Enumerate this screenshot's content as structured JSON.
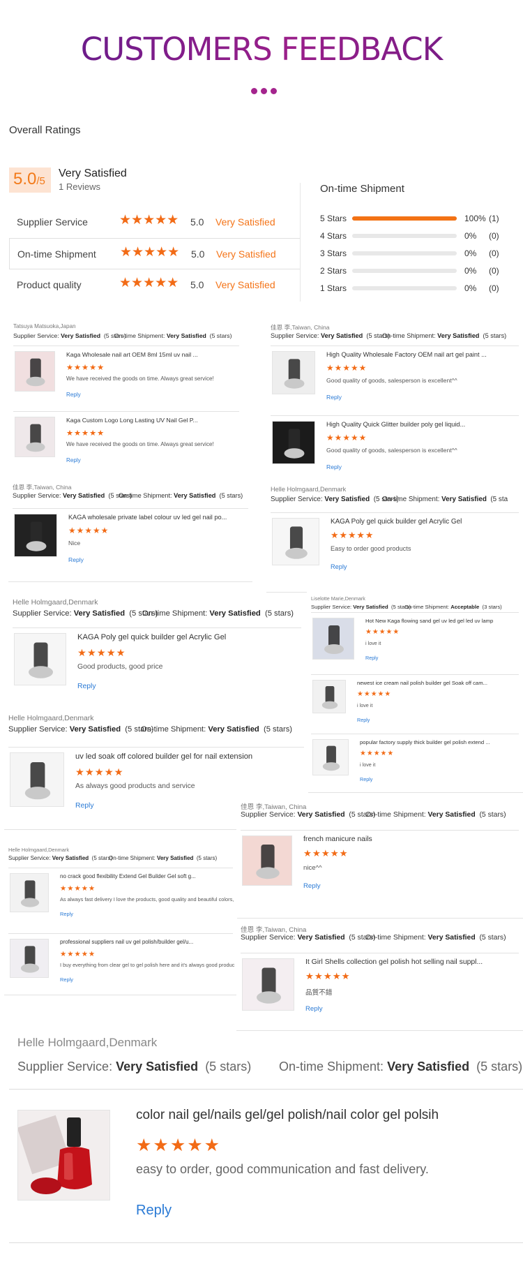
{
  "header": {
    "title": "CUSTOMERS FEEDBACK"
  },
  "overall": {
    "label": "Overall Ratings",
    "score": "5.0",
    "score_max": "/5",
    "summary": "Very Satisfied",
    "reviews": "1 Reviews",
    "rows": [
      {
        "label": "Supplier Service",
        "stars": 5,
        "value": "5.0",
        "text": "Very Satisfied"
      },
      {
        "label": "On-time Shipment",
        "stars": 5,
        "value": "5.0",
        "text": "Very Satisfied"
      },
      {
        "label": "Product quality",
        "stars": 5,
        "value": "5.0",
        "text": "Very Satisfied"
      }
    ],
    "shipment_title": "On-time Shipment",
    "distribution": [
      {
        "label": "5 Stars",
        "fraction": 1.0,
        "pct": "100%",
        "count": "(1)"
      },
      {
        "label": "4 Stars",
        "fraction": 0,
        "pct": "0%",
        "count": "(0)"
      },
      {
        "label": "3 Stars",
        "fraction": 0,
        "pct": "0%",
        "count": "(0)"
      },
      {
        "label": "2 Stars",
        "fraction": 0,
        "pct": "0%",
        "count": "(0)"
      },
      {
        "label": "1 Stars",
        "fraction": 0,
        "pct": "0%",
        "count": "(0)"
      }
    ]
  },
  "accent": {
    "orange": "#f26b16",
    "purple": "#7a1f8c",
    "link": "#2a7ad5"
  },
  "reviews": {
    "r1": {
      "who": "Tatsuya Matsuoka,Japan",
      "ss_label": "Supplier Service:",
      "ss": "Very Satisfied",
      "ss_stars": "(5 stars)",
      "os_label": "On-time Shipment:",
      "os": "Very Satisfied",
      "os_stars": "(5 stars)",
      "items": [
        {
          "title": "Kaga Wholesale nail art OEM 8ml 15ml uv nail ...",
          "comment": "We have received the goods on time. Always great service!",
          "reply": "Reply",
          "icon": "nail-swatch-icon"
        },
        {
          "title": "Kaga Custom Logo Long Lasting UV Nail Gel P...",
          "comment": "We have received the goods on time. Always great service!",
          "reply": "Reply",
          "icon": "color-chart-icon"
        }
      ]
    },
    "r2": {
      "who": "佳恩 李,Taiwan, China",
      "ss_label": "Supplier Service:",
      "ss": "Very Satisfied",
      "ss_stars": "(5 stars)",
      "os_label": "On-time Shipment:",
      "os": "Very Satisfied",
      "os_stars": "(5 stars)",
      "items": [
        {
          "title": "High Quality Wholesale Factory OEM nail art gel paint ...",
          "comment": "Good quality of goods, salesperson is excellent^^",
          "reply": "Reply"
        },
        {
          "title": "High Quality Quick Glitter builder poly gel liquid...",
          "comment": "Good quality of goods, salesperson is excellent^^",
          "reply": "Reply"
        }
      ]
    },
    "r3": {
      "who": "佳恩 李,Taiwan, China",
      "ss_label": "Supplier Service:",
      "ss": "Very Satisfied",
      "ss_stars": "(5 stars)",
      "os_label": "On-time Shipment:",
      "os": "Very Satisfied",
      "os_stars": "(5 stars)",
      "items": [
        {
          "title": "KAGA wholesale private label colour uv led gel nail po...",
          "comment": "Nice",
          "reply": "Reply"
        }
      ]
    },
    "r4": {
      "who": "Helle Holmgaard,Denmark",
      "ss_label": "Supplier Service:",
      "ss": "Very Satisfied",
      "ss_stars": "(5 stars)",
      "os_label": "On-time Shipment:",
      "os": "Very Satisfied",
      "os_stars": "(5 sta",
      "items": [
        {
          "title": "KAGA Poly gel quick builder gel Acrylic Gel",
          "comment": "Easy to order good products",
          "reply": "Reply"
        }
      ]
    },
    "r5": {
      "who": "Helle Holmgaard,Denmark",
      "ss_label": "Supplier Service:",
      "ss": "Very Satisfied",
      "ss_stars": "(5 stars)",
      "os_label": "On-time Shipment:",
      "os": "Very Satisfied",
      "os_stars": "(5 stars)",
      "items": [
        {
          "title": "KAGA Poly gel quick builder gel Acrylic Gel",
          "comment": "Good products, good price",
          "reply": "Reply"
        }
      ]
    },
    "r6": {
      "who": "Liselotte Marie,Denmark",
      "ss_label": "Supplier Service:",
      "ss": "Very Satisfied",
      "ss_stars": "(5 stars)",
      "os_label": "On-time Shipment:",
      "os": "Acceptable",
      "os_stars": "(3 stars)",
      "items": [
        {
          "title": "Hot New Kaga flowing sand gel uv led gel led uv lamp",
          "comment": "i love it",
          "reply": "Reply"
        },
        {
          "title": "newest ice cream nail polish builder gel Soak off cam...",
          "comment": "i love it",
          "reply": "Reply"
        },
        {
          "title": "popular factory supply thick builder gel polish extend ...",
          "comment": "i love it",
          "reply": "Reply"
        }
      ]
    },
    "r7": {
      "who": "Helle Holmgaard,Denmark",
      "ss_label": "Supplier Service:",
      "ss": "Very Satisfied",
      "ss_stars": "(5 stars)",
      "os_label": "On-time Shipment:",
      "os": "Very Satisfied",
      "os_stars": "(5 stars)",
      "items": [
        {
          "title": "uv led soak off colored builder gel for nail extension",
          "comment": "As always good products and service",
          "reply": "Reply"
        }
      ]
    },
    "r8": {
      "who": "佳恩 李,Taiwan, China",
      "ss_label": "Supplier Service:",
      "ss": "Very Satisfied",
      "ss_stars": "(5 stars)",
      "os_label": "On-time Shipment:",
      "os": "Very Satisfied",
      "os_stars": "(5 stars)",
      "items": [
        {
          "title": "french manicure nails",
          "comment": "nice^^",
          "reply": "Reply"
        }
      ]
    },
    "r9": {
      "who": "Helle Holmgaard,Denmark",
      "ss_label": "Supplier Service:",
      "ss": "Very Satisfied",
      "ss_stars": "(5 stars)",
      "os_label": "On-time Shipment:",
      "os": "Very Satisfied",
      "os_stars": "(5 stars)",
      "items": [
        {
          "title": "no crack good flexibility Extend Gel Builder Gel soft g...",
          "comment": "As always fast delivery I love the products, good quality and beautiful colors,",
          "reply": "Reply"
        },
        {
          "title": "professional suppliers nail uv gel polish/builder gel/u...",
          "comment": "I buy everything from clear gel to gel polish here and it's always good produc",
          "reply": "Reply"
        }
      ]
    },
    "r10": {
      "who": "佳恩 李,Taiwan, China",
      "ss_label": "Supplier Service:",
      "ss": "Very Satisfied",
      "ss_stars": "(5 stars)",
      "os_label": "On-time Shipment:",
      "os": "Very Satisfied",
      "os_stars": "(5 stars)",
      "items": [
        {
          "title": "It Girl Shells collection gel polish hot selling nail suppl...",
          "comment": "品質不錯",
          "reply": "Reply"
        }
      ]
    },
    "r11": {
      "who": "Helle Holmgaard,Denmark",
      "ss_label": "Supplier Service:",
      "ss": "Very Satisfied",
      "ss_stars": "(5 stars)",
      "os_label": "On-time Shipment:",
      "os": "Very Satisfied",
      "os_stars": "(5 stars)",
      "items": [
        {
          "title": "color nail gel/nails gel/gel polish/nail color gel polsih",
          "comment": "easy to order, good communication and fast delivery.",
          "reply": "Reply"
        }
      ]
    }
  },
  "stars_glyph": "★★★★★"
}
